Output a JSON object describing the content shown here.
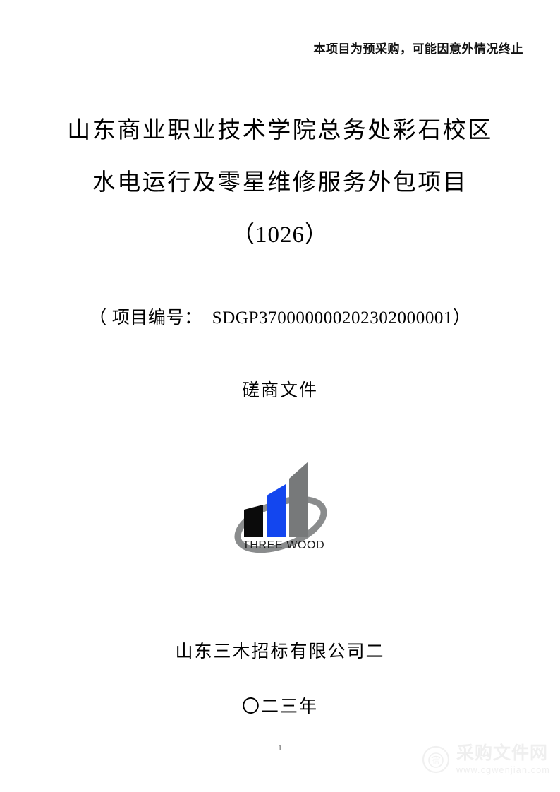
{
  "document": {
    "notice": "本项目为预采购，可能因意外情况终止",
    "title_lines": [
      "山东商业职业技术学院总务处彩石校区",
      "水电运行及零星维修服务外包项目",
      "（1026）"
    ],
    "project_number_label": "（ 项目编号：",
    "project_number_value": "SDGP370000000202302000001）",
    "doc_type": "磋商文件",
    "issuer": "山东三木招标有限公司二",
    "date": "〇二三年",
    "page_number": "1"
  },
  "logo": {
    "wordmark": "THREE WOOD",
    "bar_colors": [
      "#0b0b0b",
      "#1346ef",
      "#77797a"
    ],
    "ring_color": "#8a8c8d",
    "wordmark_color": "#1a1a1a"
  },
  "watermark": {
    "title": "采购文件网",
    "url": "www.cgwenjian.com",
    "color": "#efefef"
  }
}
